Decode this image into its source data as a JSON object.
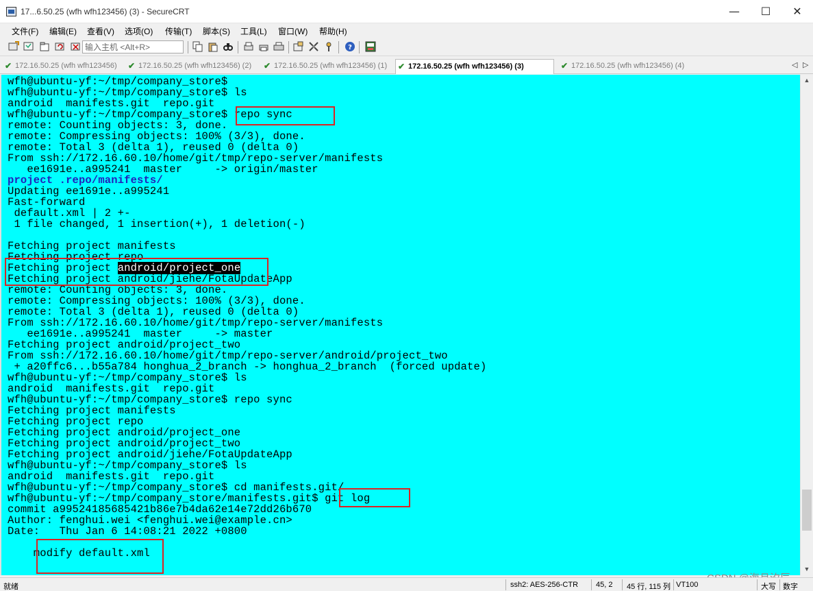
{
  "window": {
    "title": "17...6.50.25 (wfh wfh123456) (3) - SecureCRT",
    "minimize": "—",
    "maximize": "☐",
    "close": "✕"
  },
  "menu": [
    "文件(F)",
    "编辑(E)",
    "查看(V)",
    "选项(O)",
    "传输(T)",
    "脚本(S)",
    "工具(L)",
    "窗口(W)",
    "帮助(H)"
  ],
  "toolbar": {
    "host_placeholder": "输入主机 <Alt+R>"
  },
  "tabs": [
    {
      "label": "172.16.50.25 (wfh wfh123456)"
    },
    {
      "label": "172.16.50.25 (wfh wfh123456) (2)"
    },
    {
      "label": "172.16.50.25 (wfh wfh123456) (1)"
    },
    {
      "label": "172.16.50.25 (wfh wfh123456) (3)"
    },
    {
      "label": "172.16.50.25 (wfh wfh123456) (4)"
    }
  ],
  "tab_nav": {
    "prev": "◁",
    "next": "▷"
  },
  "terminal": {
    "background": "#00ffff",
    "lines": [
      "wfh@ubuntu-yf:~/tmp/company_store$",
      "wfh@ubuntu-yf:~/tmp/company_store$ ls",
      "android  manifests.git  repo.git",
      "wfh@ubuntu-yf:~/tmp/company_store$ repo sync",
      "remote: Counting objects: 3, done.",
      "remote: Compressing objects: 100% (3/3), done.",
      "remote: Total 3 (delta 1), reused 0 (delta 0)",
      "From ssh://172.16.60.10/home/git/tmp/repo-server/manifests",
      "   ee1691e..a995241  master     -> origin/master",
      "project .repo/manifests/",
      "Updating ee1691e..a995241",
      "Fast-forward",
      " default.xml | 2 +-",
      " 1 file changed, 1 insertion(+), 1 deletion(-)",
      "",
      "Fetching project manifests",
      "Fetching project repo",
      "Fetching project android/project_one",
      "Fetching project android/jiehe/FotaUpdateApp",
      "remote: Counting objects: 3, done.",
      "remote: Compressing objects: 100% (3/3), done.",
      "remote: Total 3 (delta 1), reused 0 (delta 0)",
      "From ssh://172.16.60.10/home/git/tmp/repo-server/manifests",
      "   ee1691e..a995241  master     -> master",
      "Fetching project android/project_two",
      "From ssh://172.16.60.10/home/git/tmp/repo-server/android/project_two",
      " + a20ffc6...b55a784 honghua_2_branch -> honghua_2_branch  (forced update)",
      "wfh@ubuntu-yf:~/tmp/company_store$ ls",
      "android  manifests.git  repo.git",
      "wfh@ubuntu-yf:~/tmp/company_store$ repo sync",
      "Fetching project manifests",
      "Fetching project repo",
      "Fetching project android/project_one",
      "Fetching project android/project_two",
      "Fetching project android/jiehe/FotaUpdateApp",
      "wfh@ubuntu-yf:~/tmp/company_store$ ls",
      "android  manifests.git  repo.git",
      "wfh@ubuntu-yf:~/tmp/company_store$ cd manifests.git/",
      "wfh@ubuntu-yf:~/tmp/company_store/manifests.git$ git log",
      "commit a99524185685421b86e7b4da62e14e72dd26b670",
      "Author: fenghui.wei <fenghui.wei@example.cn>",
      "Date:   Thu Jan 6 14:08:21 2022 +0800",
      "",
      "    modify default.xml",
      ""
    ],
    "line18_prefix": "Fetching project ",
    "line18_highlight": "android/project_one"
  },
  "watermark": "CSDN @海月汐辰",
  "status": {
    "ready": "就绪",
    "cipher": "ssh2: AES-256-CTR",
    "cursor": "45,  2",
    "size": "45 行, 115 列",
    "emulation": "VT100",
    "caps": "大写",
    "num": "数字"
  }
}
